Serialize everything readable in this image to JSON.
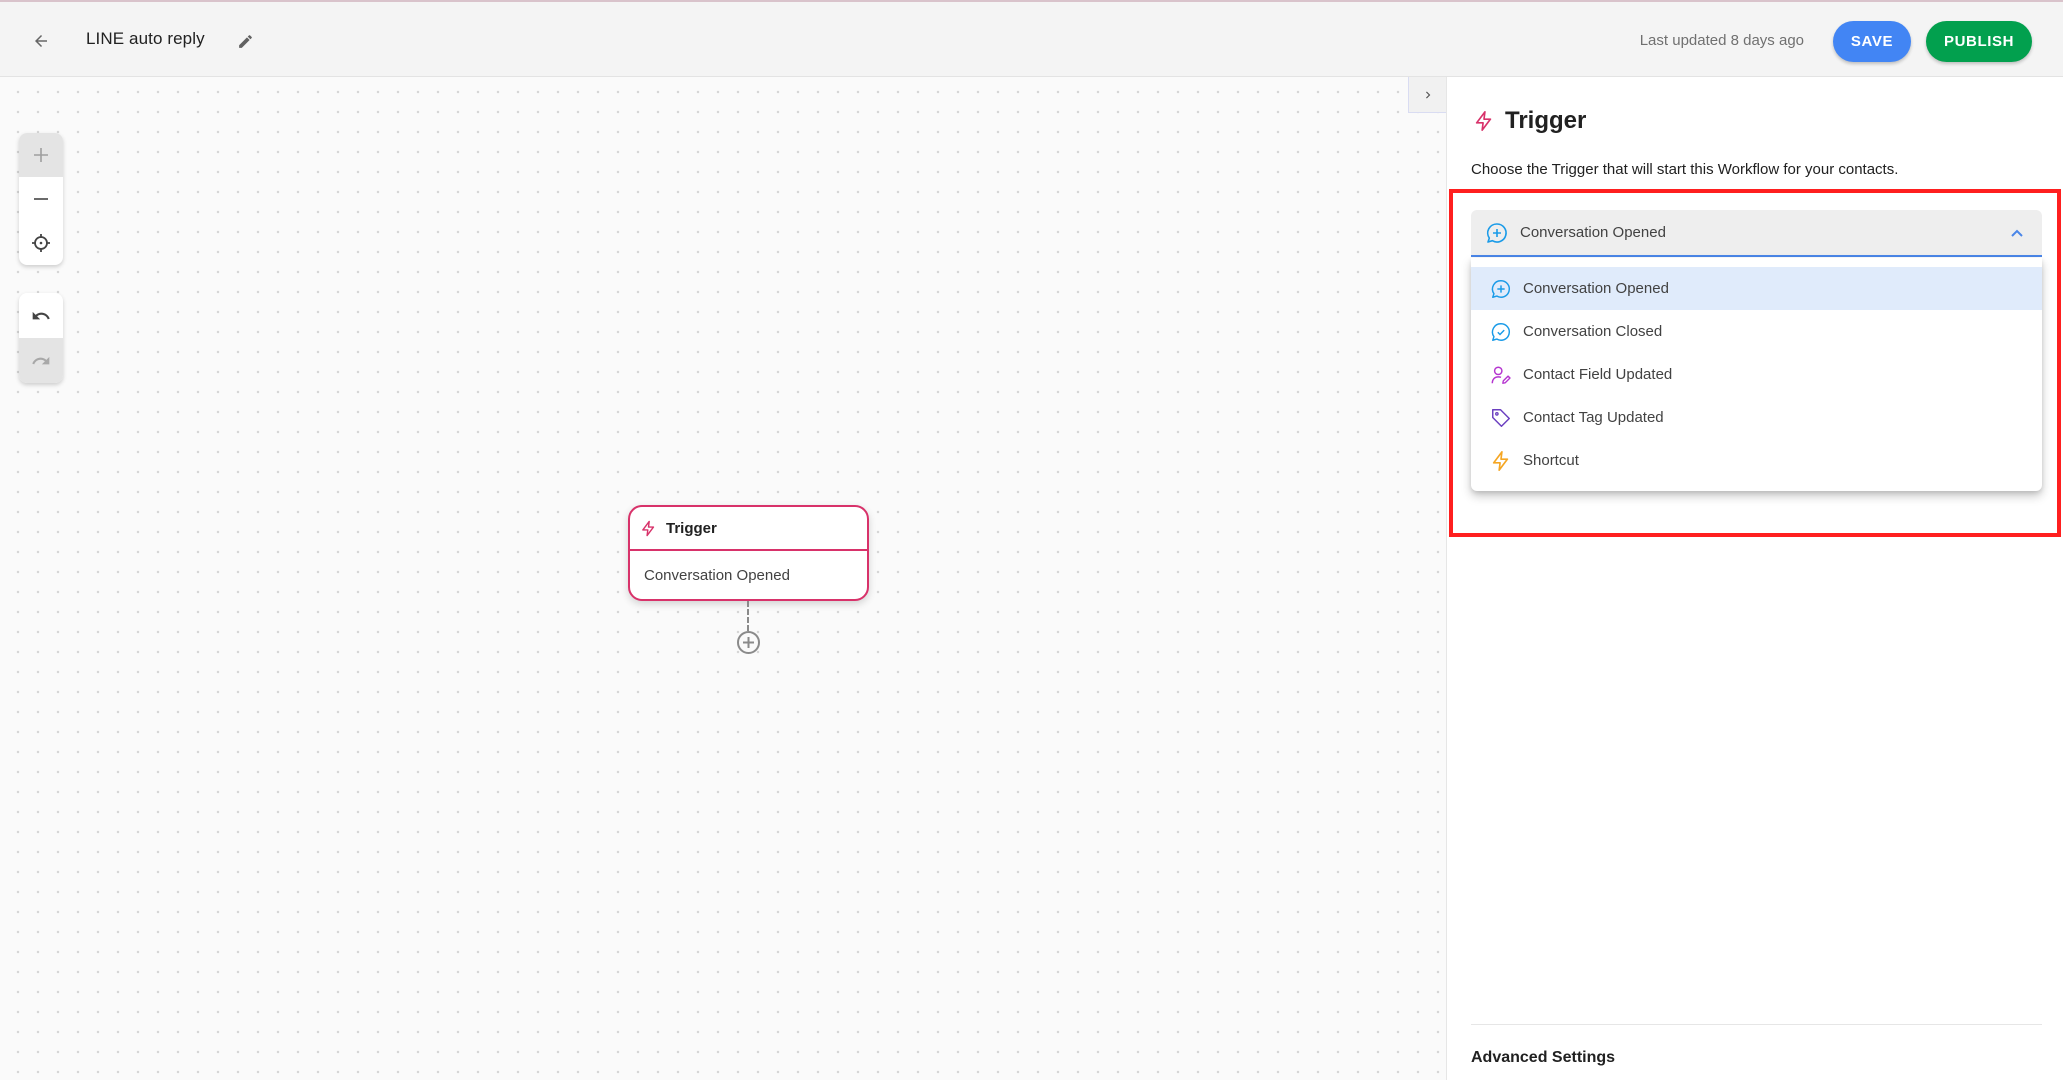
{
  "header": {
    "back_icon": "arrow-left-icon",
    "title": "LINE auto reply",
    "edit_icon": "pencil-icon",
    "last_updated": "Last updated 8 days ago",
    "save_label": "SAVE",
    "publish_label": "PUBLISH",
    "colors": {
      "save": "#4285f4",
      "publish": "#02a04e"
    }
  },
  "canvas": {
    "controls": [
      {
        "name": "zoom-in",
        "icon": "plus-icon",
        "disabled": true
      },
      {
        "name": "zoom-out",
        "icon": "minus-icon",
        "disabled": false
      },
      {
        "name": "recenter",
        "icon": "crosshair-icon",
        "disabled": false
      },
      {
        "name": "undo",
        "icon": "undo-icon",
        "disabled": false
      },
      {
        "name": "redo",
        "icon": "redo-icon",
        "disabled": true
      }
    ],
    "collapse_icon": "chevron-right-icon",
    "node": {
      "icon": "lightning-icon",
      "title": "Trigger",
      "value": "Conversation Opened",
      "accent": "#d8326a"
    },
    "add_step_icon": "plus-circle-icon"
  },
  "panel": {
    "icon": "lightning-icon",
    "title": "Trigger",
    "description": "Choose the Trigger that will start this Workflow for your contacts.",
    "select": {
      "value": "Conversation Opened",
      "icon": "chat-plus-icon",
      "expanded": true
    },
    "options": [
      {
        "label": "Conversation Opened",
        "icon": "chat-plus-icon",
        "color": "#1a9be8",
        "selected": true
      },
      {
        "label": "Conversation Closed",
        "icon": "chat-check-icon",
        "color": "#1a9be8",
        "selected": false
      },
      {
        "label": "Contact Field Updated",
        "icon": "user-edit-icon",
        "color": "#b535d0",
        "selected": false
      },
      {
        "label": "Contact Tag Updated",
        "icon": "tag-icon",
        "color": "#6b3fc0",
        "selected": false
      },
      {
        "label": "Shortcut",
        "icon": "lightning-icon",
        "color": "#f5a623",
        "selected": false
      }
    ],
    "advanced_settings": "Advanced Settings"
  }
}
